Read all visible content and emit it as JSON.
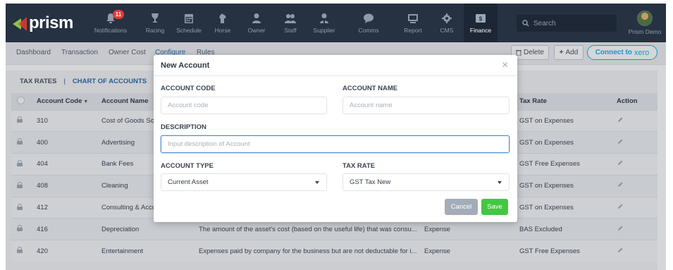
{
  "brand": {
    "name": "prism"
  },
  "nav": {
    "notifications_badge": "11",
    "items": [
      {
        "label": "Notifications",
        "icon": "bell-icon"
      },
      {
        "label": "Racing",
        "icon": "trophy-icon"
      },
      {
        "label": "Schedule",
        "icon": "calendar-icon"
      },
      {
        "label": "Horse",
        "icon": "horse-icon"
      },
      {
        "label": "Owner",
        "icon": "person-icon"
      },
      {
        "label": "Staff",
        "icon": "people-icon"
      },
      {
        "label": "Supplier",
        "icon": "supplier-icon"
      },
      {
        "label": "Comms",
        "icon": "chat-icon"
      },
      {
        "label": "Report",
        "icon": "report-icon"
      },
      {
        "label": "CMS",
        "icon": "gear-icon"
      },
      {
        "label": "Finance",
        "icon": "finance-icon",
        "active": true
      }
    ],
    "search_placeholder": "Search",
    "user_label": "Prism Demo"
  },
  "subnav": {
    "items": [
      "Dashboard",
      "Transaction",
      "Owner Cost",
      "Configure",
      "Rules"
    ],
    "active": "Configure",
    "delete_label": "Delete",
    "add_label": "Add",
    "connect_label": "Connect to",
    "xero_label": "xero"
  },
  "tabs": {
    "tax_rates": "TAX RATES",
    "separator": "|",
    "chart_of_accounts": "CHART OF ACCOUNTS"
  },
  "table": {
    "headers": {
      "account_code": "Account Code",
      "account_name": "Account Name",
      "tax_rate": "Tax Rate",
      "action": "Action"
    },
    "rows": [
      {
        "code": "310",
        "name": "Cost of Goods Sold",
        "description": "",
        "type": "",
        "tax_rate": "GST on Expenses"
      },
      {
        "code": "400",
        "name": "Advertising",
        "description": "",
        "type": "",
        "tax_rate": "GST on Expenses"
      },
      {
        "code": "404",
        "name": "Bank Fees",
        "description": "",
        "type": "",
        "tax_rate": "GST Free Expenses"
      },
      {
        "code": "408",
        "name": "Cleaning",
        "description": "",
        "type": "",
        "tax_rate": "GST on Expenses"
      },
      {
        "code": "412",
        "name": "Consulting & Accounting",
        "description": "",
        "type": "",
        "tax_rate": "GST on Expenses"
      },
      {
        "code": "416",
        "name": "Depreciation",
        "description": "The amount of the asset's cost (based on the useful life) that was consu...",
        "type": "Expense",
        "tax_rate": "BAS Excluded"
      },
      {
        "code": "420",
        "name": "Entertainment",
        "description": "Expenses paid by company for the business but are not deductable for i...",
        "type": "Expense",
        "tax_rate": "GST Free Expenses"
      }
    ]
  },
  "modal": {
    "title": "New Account",
    "close_symbol": "×",
    "account_code_label": "ACCOUNT CODE",
    "account_code_placeholder": "Account code",
    "account_name_label": "ACCOUNT NAME",
    "account_name_placeholder": "Account name",
    "description_label": "DESCRIPTION",
    "description_placeholder": "Input description of Account",
    "account_type_label": "ACCOUNT TYPE",
    "account_type_value": "Current Asset",
    "tax_rate_label": "TAX RATE",
    "tax_rate_value": "GST Tax New",
    "cancel_label": "Cancel",
    "save_label": "Save"
  },
  "colors": {
    "nav_bg": "#263142",
    "accent_blue": "#2b6cb0",
    "save_green": "#43c743",
    "cancel_gray": "#a3adb8",
    "badge_red": "#e53935",
    "xero_blue": "#13b5ea"
  }
}
